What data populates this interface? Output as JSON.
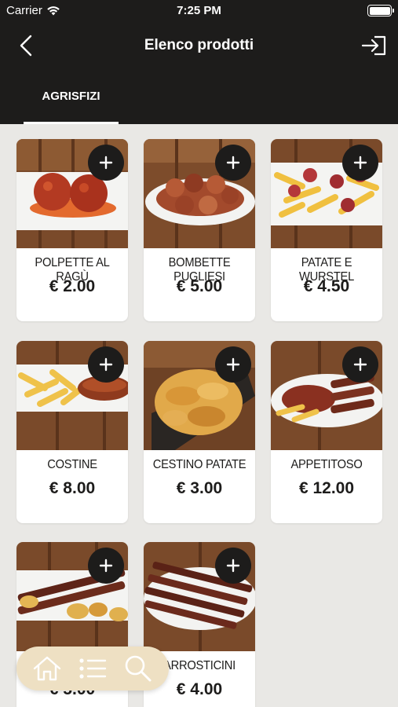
{
  "status_bar": {
    "carrier": "Carrier",
    "time": "7:25 PM"
  },
  "header": {
    "title": "Elenco prodotti",
    "back_icon": "chevron-left-icon",
    "logout_icon": "sign-in-icon"
  },
  "tabs": [
    {
      "label": "AGRISFIZI",
      "selected": true
    }
  ],
  "products": [
    {
      "name": "POLPETTE AL RAGÙ",
      "price": "€ 2.00"
    },
    {
      "name": "BOMBETTE PUGLIESI",
      "price": "€ 5.00"
    },
    {
      "name": "PATATE E WURSTEL",
      "price": "€ 4.50"
    },
    {
      "name": "COSTINE",
      "price": "€ 8.00"
    },
    {
      "name": "CESTINO PATATE",
      "price": "€ 3.00"
    },
    {
      "name": "APPETITOSO",
      "price": "€ 12.00"
    },
    {
      "name": "",
      "price": "€ 5.00"
    },
    {
      "name": "ARROSTICINI",
      "price": "€ 4.00"
    }
  ],
  "bottom_nav": [
    {
      "icon": "home-icon"
    },
    {
      "icon": "list-icon"
    },
    {
      "icon": "search-icon"
    }
  ],
  "colors": {
    "bar_background": "#1d1c1b",
    "page_background": "#e9e8e5",
    "bottom_nav_background": "#eee0c3",
    "add_button": "#1d1c1b"
  }
}
